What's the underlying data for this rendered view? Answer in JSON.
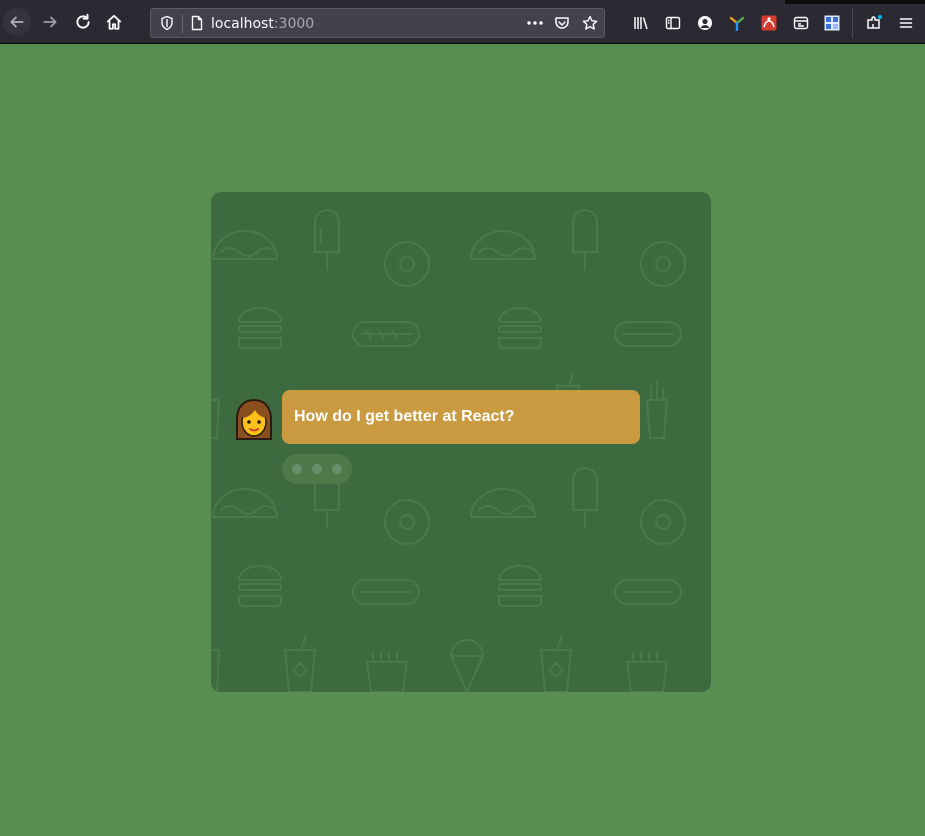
{
  "browser": {
    "url_host": "localhost",
    "url_port": ":3000",
    "icons": [
      "back-arrow-icon",
      "forward-arrow-icon",
      "reload-icon",
      "home-icon",
      "shield-icon",
      "page-icon",
      "more-icon",
      "pocket-icon",
      "bookmark-star-icon",
      "library-icon",
      "sidebar-icon",
      "account-icon",
      "extension-tri-icon",
      "extension-red-icon",
      "extension-dev-icon",
      "extension-grid-icon",
      "extensions-puzzle-icon",
      "hamburger-menu-icon"
    ]
  },
  "chat": {
    "message": "How do I get better at React?",
    "avatar": "woman-emoji",
    "typing_indicator": "typing-dots"
  },
  "colors": {
    "page_background": "#588f51",
    "card_background": "#3e6a3f",
    "bubble": "#ca9a41",
    "toolbar": "#2b2a33"
  }
}
